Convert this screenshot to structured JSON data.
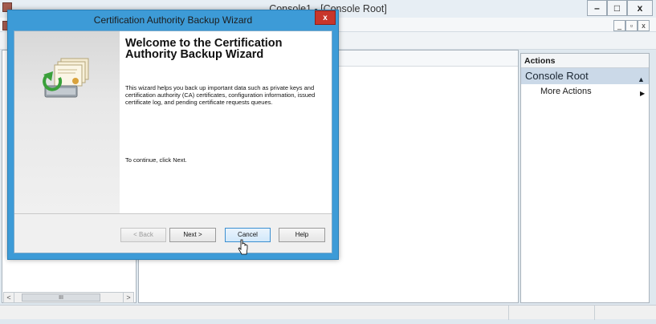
{
  "console": {
    "title": "Console1 - [Console Root]",
    "min_label": "–",
    "max_label": "□",
    "close_label": "x",
    "child_min_label": "_",
    "child_restore_label": "▫",
    "child_close_label": "x"
  },
  "tree": {
    "scroll_left": "<",
    "scroll_thumb": "III",
    "scroll_right": ">"
  },
  "actions": {
    "header": "Actions",
    "section": "Console Root",
    "collapse_icon": "▲",
    "items": [
      {
        "label": "More Actions",
        "arrow": "▶"
      }
    ]
  },
  "wizard": {
    "title": "Certification Authority Backup Wizard",
    "close_label": "x",
    "heading": "Welcome to the Certification Authority Backup Wizard",
    "description": "This wizard helps you back up important data such as private keys and certification authority (CA) certificates, configuration information, issued certificate log, and pending certificate requests queues.",
    "continue_text": "To continue, click Next.",
    "buttons": {
      "back": "< Back",
      "next": "Next >",
      "cancel": "Cancel",
      "help": "Help"
    }
  },
  "icons": {
    "app_icon": "mmc-app-icon",
    "wizard_graphic": "certificate-backup-icon",
    "cursor": "mouse-pointer-icon"
  }
}
